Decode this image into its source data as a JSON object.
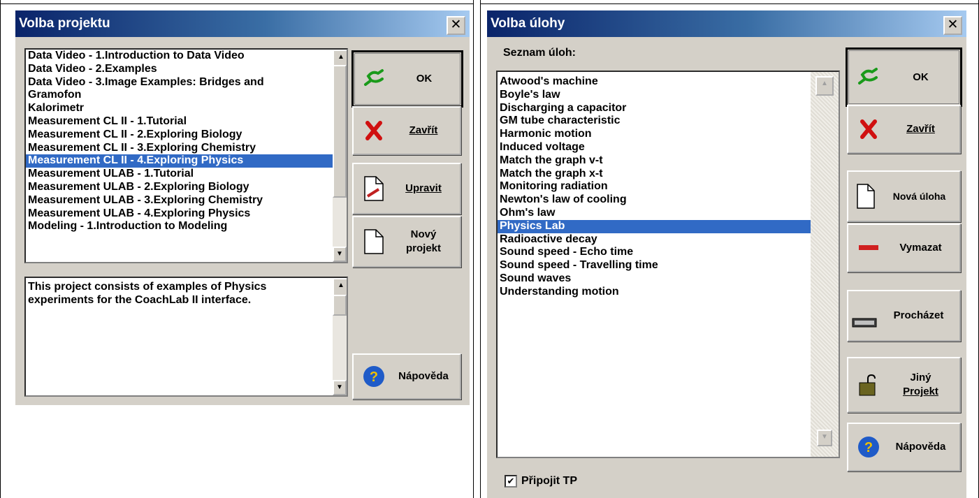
{
  "left": {
    "title": "Volba projektu",
    "close_glyph": "✕",
    "projects": [
      "Data Video - 1.Introduction to Data Video",
      "Data Video - 2.Examples",
      "Data Video - 3.Image Examples: Bridges and",
      "Gramofon",
      "Kalorimetr",
      "Measurement CL II - 1.Tutorial",
      "Measurement CL II - 2.Exploring Biology",
      "Measurement CL II - 3.Exploring Chemistry",
      "Measurement CL II - 4.Exploring Physics",
      "Measurement ULAB - 1.Tutorial",
      "Measurement ULAB - 2.Exploring Biology",
      "Measurement ULAB - 3.Exploring Chemistry",
      "Measurement ULAB - 4.Exploring Physics",
      "Modeling - 1.Introduction to Modeling"
    ],
    "selected_index": 8,
    "description": "This project consists of examples of Physics experiments for the CoachLab II interface.",
    "buttons": {
      "ok": "OK",
      "close": "Zavřít",
      "edit": "Upravit",
      "new_project_1": "Nový",
      "new_project_2": "projekt",
      "help": "Nápověda"
    }
  },
  "right": {
    "title": "Volba úlohy",
    "close_glyph": "✕",
    "list_label": "Seznam úloh:",
    "tasks": [
      "Atwood's machine",
      "Boyle's law",
      "Discharging a capacitor",
      "GM tube characteristic",
      "Harmonic motion",
      "Induced voltage",
      "Match the graph v-t",
      "Match the graph x-t",
      "Monitoring radiation",
      "Newton's law of cooling",
      "Ohm's law",
      "Physics Lab",
      "Radioactive decay",
      "Sound speed - Echo time",
      "Sound speed - Travelling time",
      "Sound waves",
      "Understanding motion"
    ],
    "selected_index": 11,
    "checkbox_label": "Připojit TP",
    "checkbox_checked": true,
    "buttons": {
      "ok": "OK",
      "close": "Zavřít",
      "new_task": "Nová úloha",
      "delete": "Vymazat",
      "browse": "Procházet",
      "other_project_1": "Jiný",
      "other_project_2": "Projekt",
      "help": "Nápověda"
    }
  },
  "colors": {
    "selection": "#316ac5",
    "titlebar_start": "#0a246a",
    "titlebar_end": "#a6caf0",
    "dialog_face": "#d4d0c8"
  }
}
